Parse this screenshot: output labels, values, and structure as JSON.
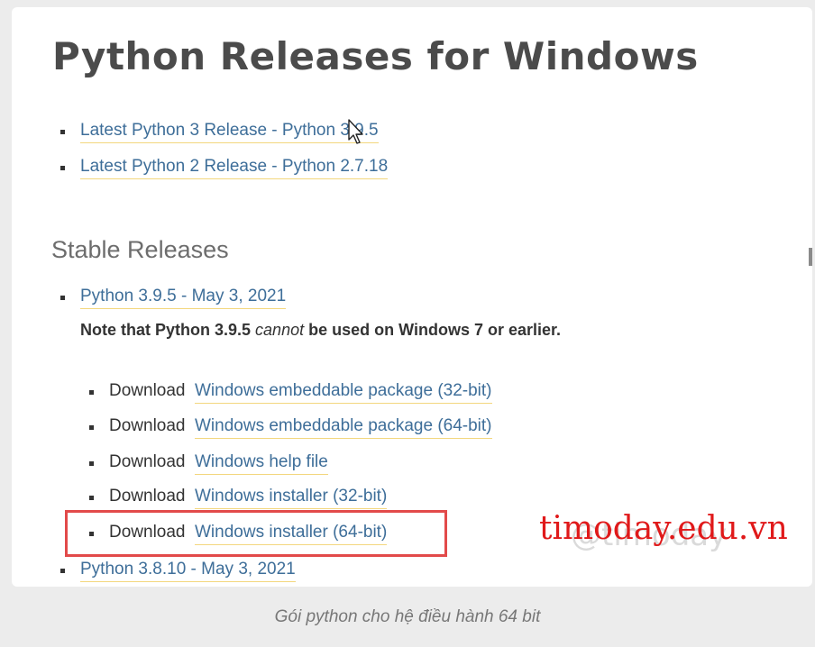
{
  "page": {
    "title": "Python Releases for Windows"
  },
  "latest": [
    {
      "label": "Latest Python 3 Release - Python 3.9.5"
    },
    {
      "label": "Latest Python 2 Release - Python 2.7.18"
    }
  ],
  "stable": {
    "heading": "Stable Releases",
    "release": {
      "label": "Python 3.9.5 - May 3, 2021",
      "note_prefix": "Note that Python 3.9.5",
      "note_emphasis": "cannot",
      "note_suffix": "be used on Windows 7 or earlier.",
      "downloads": [
        {
          "prefix": "Download",
          "link": "Windows embeddable package (32-bit)"
        },
        {
          "prefix": "Download",
          "link": "Windows embeddable package (64-bit)"
        },
        {
          "prefix": "Download",
          "link": "Windows help file"
        },
        {
          "prefix": "Download",
          "link": "Windows installer (32-bit)"
        },
        {
          "prefix": "Download",
          "link": "Windows installer (64-bit)"
        }
      ]
    },
    "next_release": {
      "label": "Python 3.8.10 - May 3, 2021"
    }
  },
  "watermark": {
    "text": "timoday.edu.vn",
    "faded_text": "@timoday"
  },
  "caption": "Gói python cho hệ điều hành 64 bit",
  "colors": {
    "link": "#3e6e99",
    "link_underline": "#f3d77e",
    "highlight_box": "#e24a4a",
    "watermark": "#e0191a"
  },
  "icons": {
    "cursor": "mouse-pointer-icon"
  }
}
